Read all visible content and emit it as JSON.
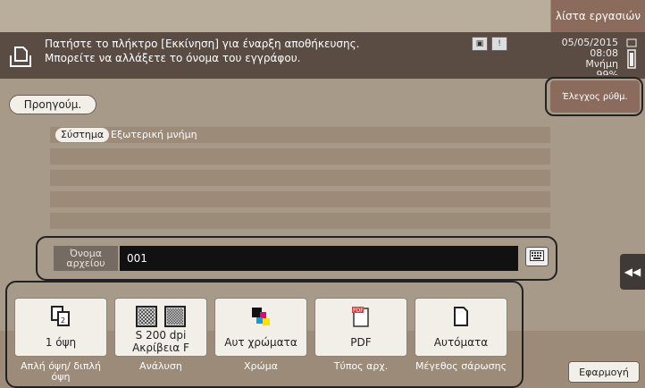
{
  "header": {
    "job_list_label": "λίστα εργασιών",
    "message_line1": "Πατήστε το πλήκτρο [Εκκίνηση] για έναρξη αποθήκευσης.",
    "message_line2": "Μπορείτε να αλλάξετε το όνομα του εγγράφου.",
    "date": "05/05/2015",
    "time": "08:08",
    "memory_label": "Μνήμη",
    "memory_percent": "99%"
  },
  "nav": {
    "previous_label": "Προηγούμ.",
    "check_settings_label": "Έλεγχος ρύθμ."
  },
  "breadcrumb": {
    "system_label": "Σύστημα",
    "location_label": "Εξωτερική μνήμη"
  },
  "filename": {
    "label": "Όνομα αρχείου",
    "value": "001"
  },
  "functions": [
    {
      "icon": "simplex-icon",
      "value": "1 όψη",
      "caption": "Απλή όψη/ διπλή όψη"
    },
    {
      "icon": "resolution-icon",
      "value": "S 200 dpi Ακρίβεια F",
      "caption": "Ανάλυση"
    },
    {
      "icon": "color-icon",
      "value": "Αυτ χρώματα",
      "caption": "Χρώμα"
    },
    {
      "icon": "pdf-file-icon",
      "value": "PDF",
      "caption": "Τύπος αρχ."
    },
    {
      "icon": "page-size-icon",
      "value": "Αυτόματα",
      "caption": "Μέγεθος σάρωσης"
    }
  ],
  "apply_label": "Εφαρμογή",
  "colors": {
    "accent": "#8a6b5c",
    "background": "#a89a88"
  }
}
